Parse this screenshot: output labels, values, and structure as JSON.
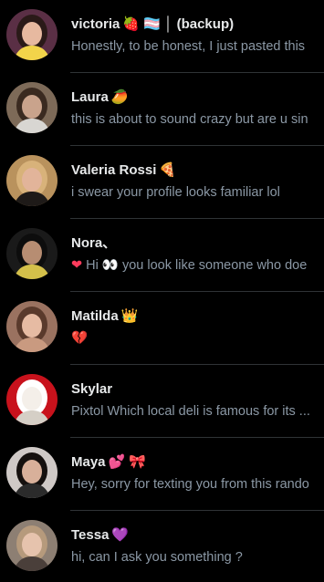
{
  "conversations": [
    {
      "name": "victoria",
      "name_deco": "🍓 🏳️‍⚧️ │ (backup)",
      "preview": "Honestly, to be honest, I just pasted this",
      "preview_lead": "",
      "avatar": {
        "bg": "#5a2f45",
        "hair": "#2a1a18",
        "skin": "#e7b9a0",
        "accent": "#f2d44a"
      }
    },
    {
      "name": "Laura",
      "name_deco": "🥭",
      "preview": "this is about to sound crazy but are u sin",
      "preview_lead": "",
      "avatar": {
        "bg": "#7d6a58",
        "hair": "#3a2a20",
        "skin": "#c9a38c",
        "accent": "#d8d6d2"
      }
    },
    {
      "name": "Valeria Rossi",
      "name_deco": "🍕",
      "preview": "i swear your profile looks familiar lol",
      "preview_lead": "",
      "avatar": {
        "bg": "#b9925d",
        "hair": "#d8b27a",
        "skin": "#e2b49a",
        "accent": "#1e1a18"
      }
    },
    {
      "name": "Nora、",
      "name_deco": "",
      "preview": "Hi 👀 you look like someone who doe",
      "preview_lead": "❤",
      "avatar": {
        "bg": "#1a1a1a",
        "hair": "#0d0d0d",
        "skin": "#b78d72",
        "accent": "#d4c04a"
      }
    },
    {
      "name": "Matilda",
      "name_deco": "👑",
      "preview": "💔",
      "preview_lead": "",
      "avatar": {
        "bg": "#9a7260",
        "hair": "#5a3a2c",
        "skin": "#e6bba3",
        "accent": "#c99a80"
      }
    },
    {
      "name": "Skylar",
      "name_deco": "",
      "preview": "Pixtol Which local deli is famous for its ...",
      "preview_lead": "",
      "avatar": {
        "bg": "#c8121c",
        "hair": "#ffffff",
        "skin": "#f4efe9",
        "accent": "#d5cfc6"
      }
    },
    {
      "name": "Maya",
      "name_deco": "💕 🎀",
      "preview": "Hey, sorry for texting you from this rando",
      "preview_lead": "",
      "avatar": {
        "bg": "#cfc9c6",
        "hair": "#15100e",
        "skin": "#d8b09a",
        "accent": "#2b2b2b"
      }
    },
    {
      "name": "Tessa",
      "name_deco": "💜",
      "preview": "hi, can I ask you something ?",
      "preview_lead": "",
      "avatar": {
        "bg": "#8d7f73",
        "hair": "#b69a7c",
        "skin": "#e6c3ad",
        "accent": "#4a3f3a"
      }
    }
  ],
  "colors": {
    "background": "#000000",
    "name_text": "#e7e9ea",
    "preview_text": "#8b98a5",
    "divider": "#2f3336"
  }
}
